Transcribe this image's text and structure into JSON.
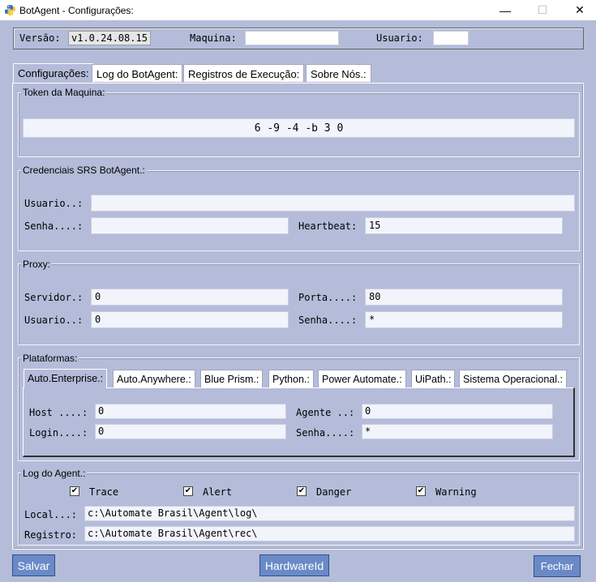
{
  "window": {
    "title": "BotAgent - Configurações:",
    "min_glyph": "—",
    "max_glyph": "☐",
    "close_glyph": "✕"
  },
  "info": {
    "version_label": "Versão:",
    "version_value": "v1.0.24.08.15",
    "machine_label": "Maquina:",
    "machine_value": "",
    "user_label": "Usuario:",
    "user_value": ""
  },
  "tabs": [
    {
      "label": "Configurações:"
    },
    {
      "label": "Log do BotAgent:"
    },
    {
      "label": "Registros de Execução:"
    },
    {
      "label": "Sobre Nós.:"
    }
  ],
  "token": {
    "title": "Token da Maquina:",
    "value": "6            -9      -4      -b        3                    0"
  },
  "credentials": {
    "title": "Credenciais SRS BotAgent.:",
    "user_label": "Usuario..:",
    "user_value": "",
    "password_label": "Senha....:",
    "password_value": "",
    "heartbeat_label": "Heartbeat:",
    "heartbeat_value": "15"
  },
  "proxy": {
    "title": "Proxy:",
    "server_label": "Servidor.:",
    "server_value": "0",
    "port_label": "Porta....:",
    "port_value": "80",
    "user_label": "Usuario..:",
    "user_value": "0",
    "password_label": "Senha....:",
    "password_value": "*"
  },
  "platforms": {
    "title": "Plataformas:",
    "tabs": [
      {
        "label": "Auto.Enterprise.:"
      },
      {
        "label": "Auto.Anywhere.:"
      },
      {
        "label": "Blue Prism.:"
      },
      {
        "label": "Python.:"
      },
      {
        "label": "Power Automate.:"
      },
      {
        "label": "UiPath.:"
      },
      {
        "label": "Sistema Operacional.:"
      }
    ],
    "host_label": "Host ....:",
    "host_value": "0",
    "agent_label": "Agente ..:",
    "agent_value": "0",
    "login_label": "Login....:",
    "login_value": "0",
    "password_label": "Senha....:",
    "password_value": "*"
  },
  "log": {
    "title": "Log do Agent.:",
    "checks": [
      {
        "label": "Trace",
        "checked": true
      },
      {
        "label": "Alert",
        "checked": true
      },
      {
        "label": "Danger",
        "checked": true
      },
      {
        "label": "Warning",
        "checked": true
      }
    ],
    "check_glyph": "✔",
    "local_label": "Local...:",
    "local_value": "c:\\Automate Brasil\\Agent\\log\\",
    "registry_label": "Registro:",
    "registry_value": "c:\\Automate Brasil\\Agent\\rec\\"
  },
  "buttons": {
    "save": "Salvar",
    "hardware_id": "HardwareId",
    "close": "Fechar"
  },
  "colors": {
    "background": "#b4bcd9",
    "button": "#6a8ac7"
  }
}
